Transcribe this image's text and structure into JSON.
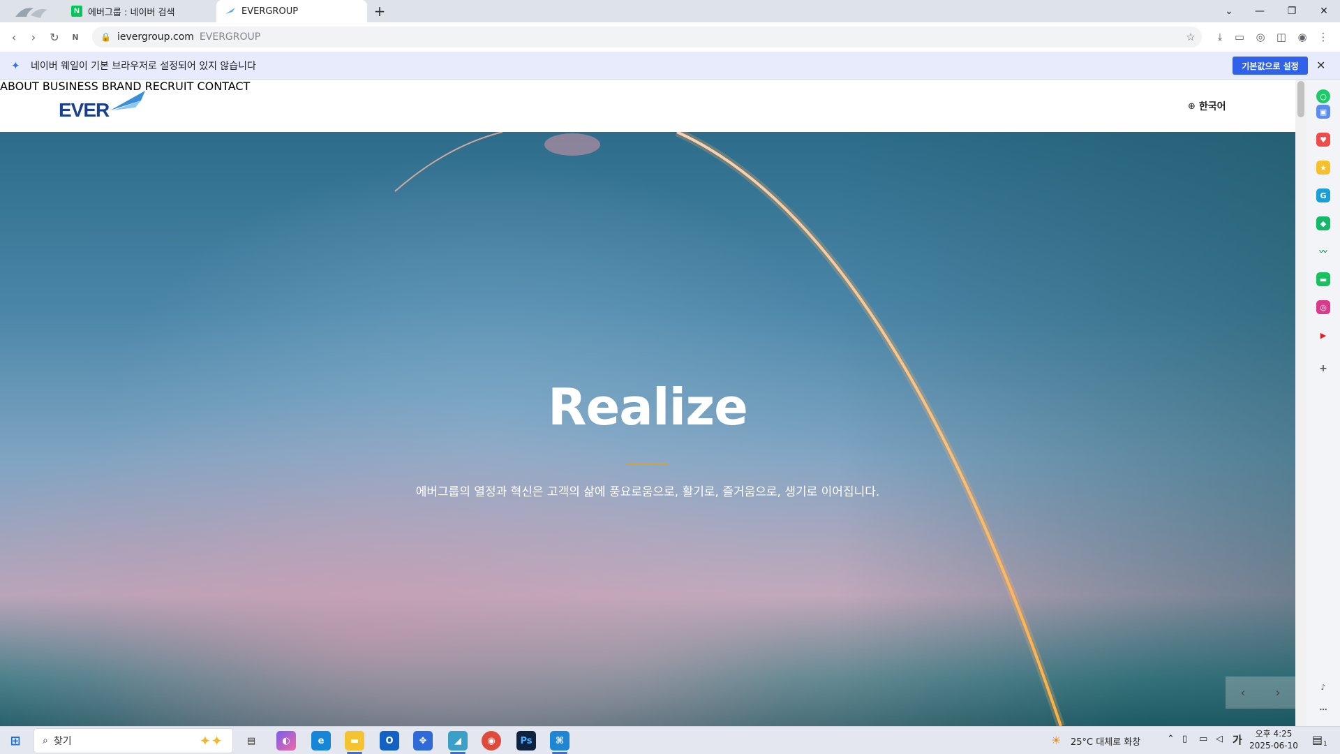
{
  "browser": {
    "tabs": [
      {
        "label": "에버그룹 : 네이버 검색",
        "favicon": "naver-icon"
      },
      {
        "label": "EVERGROUP",
        "favicon": "evergroup-icon"
      }
    ],
    "address": {
      "url": "ievergroup.com",
      "page_title": "EVERGROUP"
    }
  },
  "infobar": {
    "message": "네이버 웨일이 기본 브라우저로 설정되어 있지 않습니다",
    "button_label": "기본값으로 설정"
  },
  "site": {
    "logo_text": "EVER",
    "nav": [
      "ABOUT",
      "BUSINESS",
      "BRAND",
      "RECRUIT",
      "CONTACT"
    ],
    "language": "한국어",
    "hero": {
      "title": "Realize",
      "subtitle": "에버그룹의 열정과 혁신은 고객의 삶에 풍요로움으로, 활기로, 즐거움으로, 생기로 이어집니다."
    }
  },
  "taskbar": {
    "search_placeholder": "찾기",
    "weather": "25°C 대체로 화창",
    "ime": "가",
    "time": "오후 4:25",
    "date": "2025-06-10",
    "notification_count": "1"
  },
  "colors": {
    "brand_blue": "#1b3f8f",
    "infobar_button": "#2f62e8",
    "hero_accent_line": "#d4a23c"
  }
}
